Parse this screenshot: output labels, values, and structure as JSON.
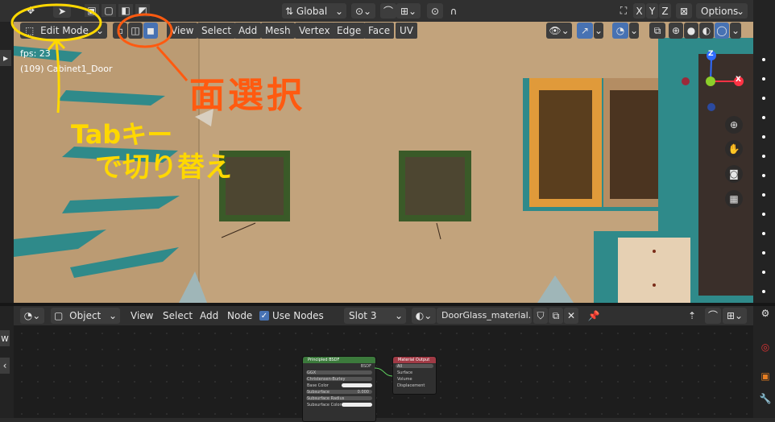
{
  "header": {
    "transform_orientation": "Global",
    "axes": [
      "X",
      "Y",
      "Z"
    ],
    "options_label": "Options"
  },
  "viewport_header": {
    "mode": "Edit Mode",
    "menus": [
      "View",
      "Select",
      "Add",
      "Mesh",
      "Vertex",
      "Edge",
      "Face",
      "UV"
    ]
  },
  "viewport": {
    "fps_text": "fps: 23",
    "object_text": "(109) Cabinet1_Door",
    "gizmo": {
      "x": "X",
      "y": "Y",
      "z": "Z"
    }
  },
  "annotations": {
    "orange_text": "面選択",
    "yellow_line1": "Tabキー",
    "yellow_line2": "で切り替え"
  },
  "node_editor": {
    "object_dropdown": "Object",
    "menus": [
      "View",
      "Select",
      "Add",
      "Node"
    ],
    "use_nodes_label": "Use Nodes",
    "slot": "Slot 3",
    "material": "DoorGlass_material...",
    "principled": {
      "title": "Principled BSDF",
      "output": "BSDF",
      "distribution": "GGX",
      "subsurface_method": "Christensen-Burley",
      "base_color": "Base Color",
      "subsurface": "Subsurface",
      "subsurface_value": "0.000",
      "subsurface_radius": "Subsurface Radius",
      "subsurface_color": "Subsurface Color"
    },
    "material_output": {
      "title": "Material Output",
      "target": "All",
      "surface": "Surface",
      "volume": "Volume",
      "displacement": "Displacement"
    }
  },
  "colors": {
    "accent": "#4772b3",
    "wall": "#c4a57e",
    "annotation_yellow": "#ffd800",
    "annotation_orange": "#ff5a10"
  }
}
